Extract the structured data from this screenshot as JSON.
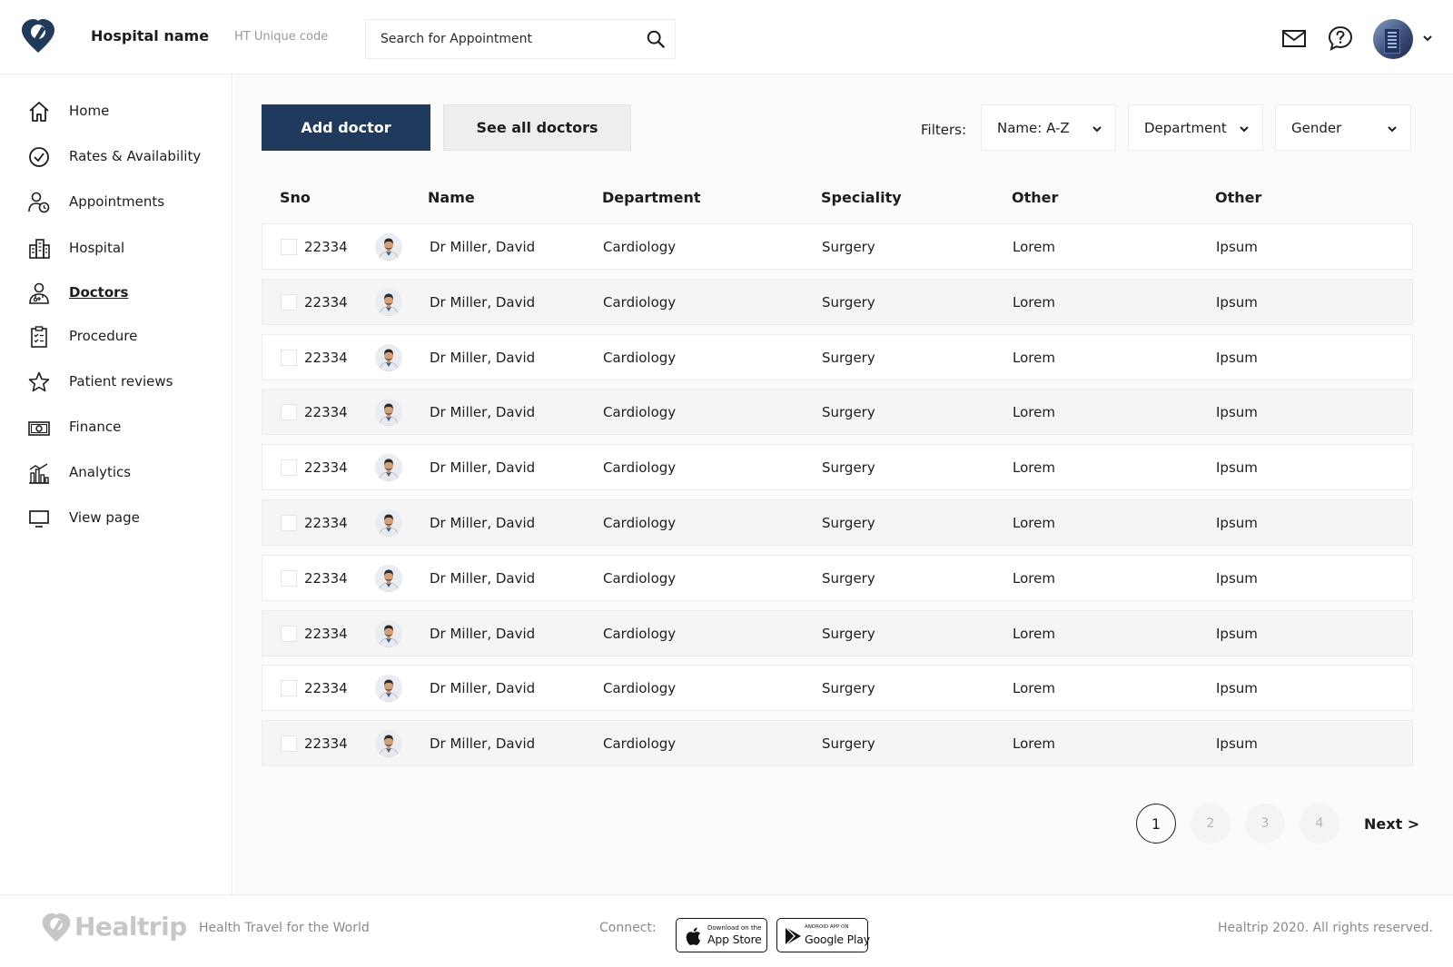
{
  "header": {
    "hospital_name": "Hospital name",
    "unique_code": "HT Unique code",
    "search_placeholder": "Search for Appointment"
  },
  "sidebar": {
    "items": [
      {
        "label": "Home",
        "icon": "home-icon",
        "active": false
      },
      {
        "label": "Rates & Availability",
        "icon": "check-circle-icon",
        "active": false
      },
      {
        "label": "Appointments",
        "icon": "user-clock-icon",
        "active": false
      },
      {
        "label": "Hospital",
        "icon": "building-icon",
        "active": false
      },
      {
        "label": "Doctors",
        "icon": "doctor-icon",
        "active": true
      },
      {
        "label": "Procedure",
        "icon": "clipboard-icon",
        "active": false
      },
      {
        "label": "Patient reviews",
        "icon": "star-icon",
        "active": false
      },
      {
        "label": "Finance",
        "icon": "money-icon",
        "active": false
      },
      {
        "label": "Analytics",
        "icon": "analytics-icon",
        "active": false
      },
      {
        "label": "View page",
        "icon": "monitor-icon",
        "active": false
      }
    ]
  },
  "toolbar": {
    "add_label": "Add doctor",
    "see_all_label": "See all doctors",
    "filters_label": "Filters:",
    "filters": [
      "Name: A-Z",
      "Department",
      "Gender"
    ]
  },
  "table": {
    "columns": [
      "Sno",
      "Name",
      "Department",
      "Speciality",
      "Other",
      "Other"
    ],
    "rows": [
      {
        "sno": "22334",
        "name": "Dr Miller, David",
        "department": "Cardiology",
        "speciality": "Surgery",
        "other1": "Lorem",
        "other2": "Ipsum"
      },
      {
        "sno": "22334",
        "name": "Dr Miller, David",
        "department": "Cardiology",
        "speciality": "Surgery",
        "other1": "Lorem",
        "other2": "Ipsum"
      },
      {
        "sno": "22334",
        "name": "Dr Miller, David",
        "department": "Cardiology",
        "speciality": "Surgery",
        "other1": "Lorem",
        "other2": "Ipsum"
      },
      {
        "sno": "22334",
        "name": "Dr Miller, David",
        "department": "Cardiology",
        "speciality": "Surgery",
        "other1": "Lorem",
        "other2": "Ipsum"
      },
      {
        "sno": "22334",
        "name": "Dr Miller, David",
        "department": "Cardiology",
        "speciality": "Surgery",
        "other1": "Lorem",
        "other2": "Ipsum"
      },
      {
        "sno": "22334",
        "name": "Dr Miller, David",
        "department": "Cardiology",
        "speciality": "Surgery",
        "other1": "Lorem",
        "other2": "Ipsum"
      },
      {
        "sno": "22334",
        "name": "Dr Miller, David",
        "department": "Cardiology",
        "speciality": "Surgery",
        "other1": "Lorem",
        "other2": "Ipsum"
      },
      {
        "sno": "22334",
        "name": "Dr Miller, David",
        "department": "Cardiology",
        "speciality": "Surgery",
        "other1": "Lorem",
        "other2": "Ipsum"
      },
      {
        "sno": "22334",
        "name": "Dr Miller, David",
        "department": "Cardiology",
        "speciality": "Surgery",
        "other1": "Lorem",
        "other2": "Ipsum"
      },
      {
        "sno": "22334",
        "name": "Dr Miller, David",
        "department": "Cardiology",
        "speciality": "Surgery",
        "other1": "Lorem",
        "other2": "Ipsum"
      }
    ]
  },
  "pagination": {
    "pages": [
      "1",
      "2",
      "3",
      "4"
    ],
    "current": "1",
    "next_label": "Next >"
  },
  "footer": {
    "brand": "Healtrip",
    "tagline": "Health Travel for the World",
    "connect_label": "Connect:",
    "app_store_small": "Download on the",
    "app_store_big": "App Store",
    "google_play_small": "ANDROID APP ON",
    "google_play_big": "Google Play",
    "copyright": "Healtrip 2020. All rights reserved."
  },
  "colors": {
    "primary": "#1f3a5c",
    "text": "#1d1d1d",
    "muted": "#9a9a9a",
    "border": "#ececec"
  }
}
